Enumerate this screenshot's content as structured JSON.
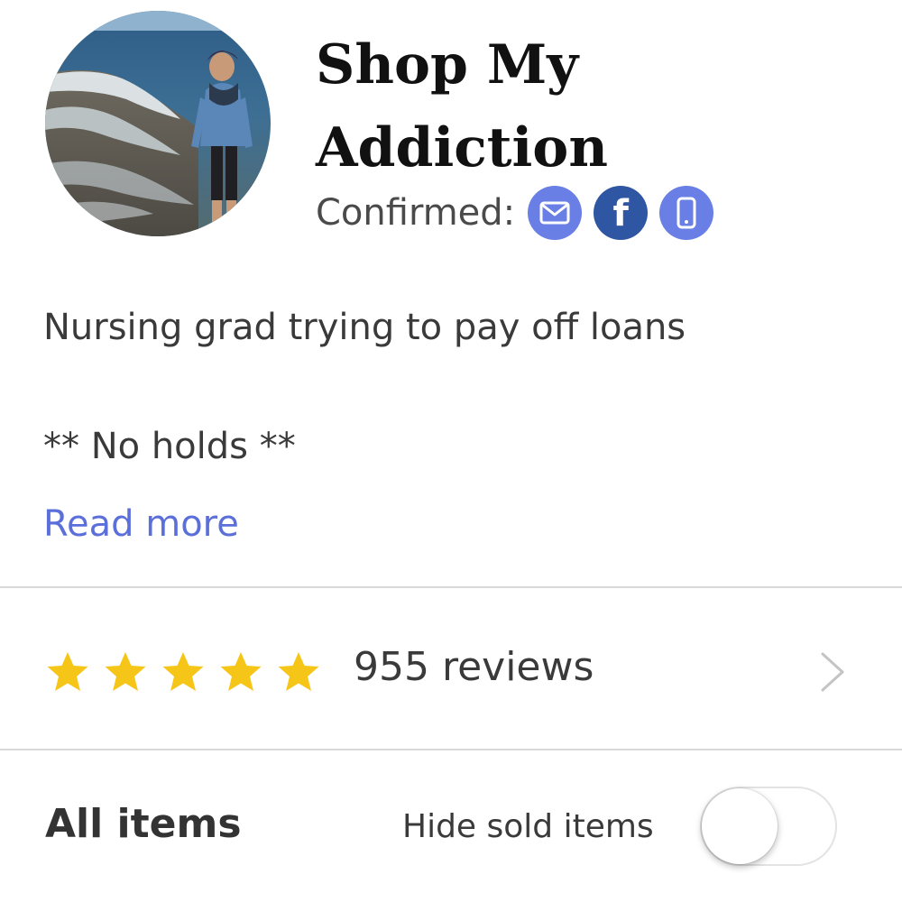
{
  "profile": {
    "shop_name": "Shop My Addiction",
    "confirmed_label": "Confirmed:",
    "verifications": [
      {
        "type": "email",
        "icon": "envelope-icon",
        "color": "#6a7fe6"
      },
      {
        "type": "facebook",
        "icon": "facebook-icon",
        "color": "#2f56a3"
      },
      {
        "type": "phone",
        "icon": "phone-icon",
        "color": "#6a7fe6"
      }
    ]
  },
  "bio": {
    "line1": "Nursing grad trying to pay off loans",
    "line2": "** No holds **",
    "read_more": "Read more",
    "read_more_color": "#5b6fdb"
  },
  "reviews": {
    "rating": 5,
    "max_rating": 5,
    "star_color": "#f5c518",
    "count_label": "955 reviews"
  },
  "items": {
    "title": "All items",
    "hide_sold_label": "Hide sold items",
    "hide_sold_enabled": false
  }
}
